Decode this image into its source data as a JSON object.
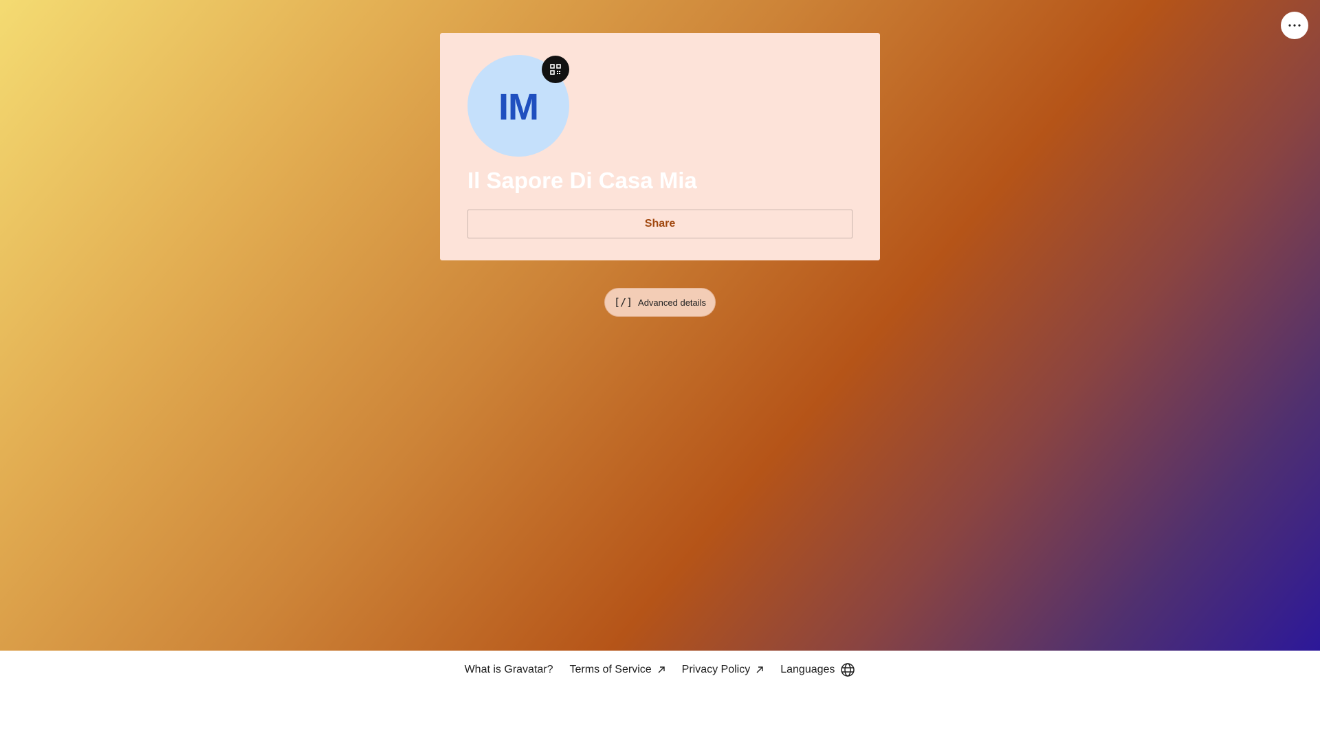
{
  "top_bar": {
    "menu_icon": "more-horizontal-icon"
  },
  "profile_card": {
    "avatar_initials": "IM",
    "avatar_bg_color": "#c5e0fb",
    "avatar_text_color": "#1f4fbf",
    "qr_icon": "qr-code-icon",
    "name": "Il Sapore Di Casa Mia",
    "share_label": "Share",
    "card_bg_color": "#fde3d9",
    "accent_color": "#a0470e"
  },
  "advanced": {
    "icon_text": "[/]",
    "label": "Advanced details"
  },
  "footer": {
    "links": [
      {
        "label": "What is Gravatar?",
        "icon": ""
      },
      {
        "label": "Terms of Service",
        "icon": "external-arrow-icon"
      },
      {
        "label": "Privacy Policy",
        "icon": "external-arrow-icon"
      },
      {
        "label": "Languages",
        "icon": "globe-icon"
      }
    ]
  },
  "colors": {
    "gradient": [
      "#f4db72",
      "#cd8438",
      "#b55418",
      "#50306f",
      "#2c1899"
    ],
    "footer_bg": "#ffffff"
  }
}
